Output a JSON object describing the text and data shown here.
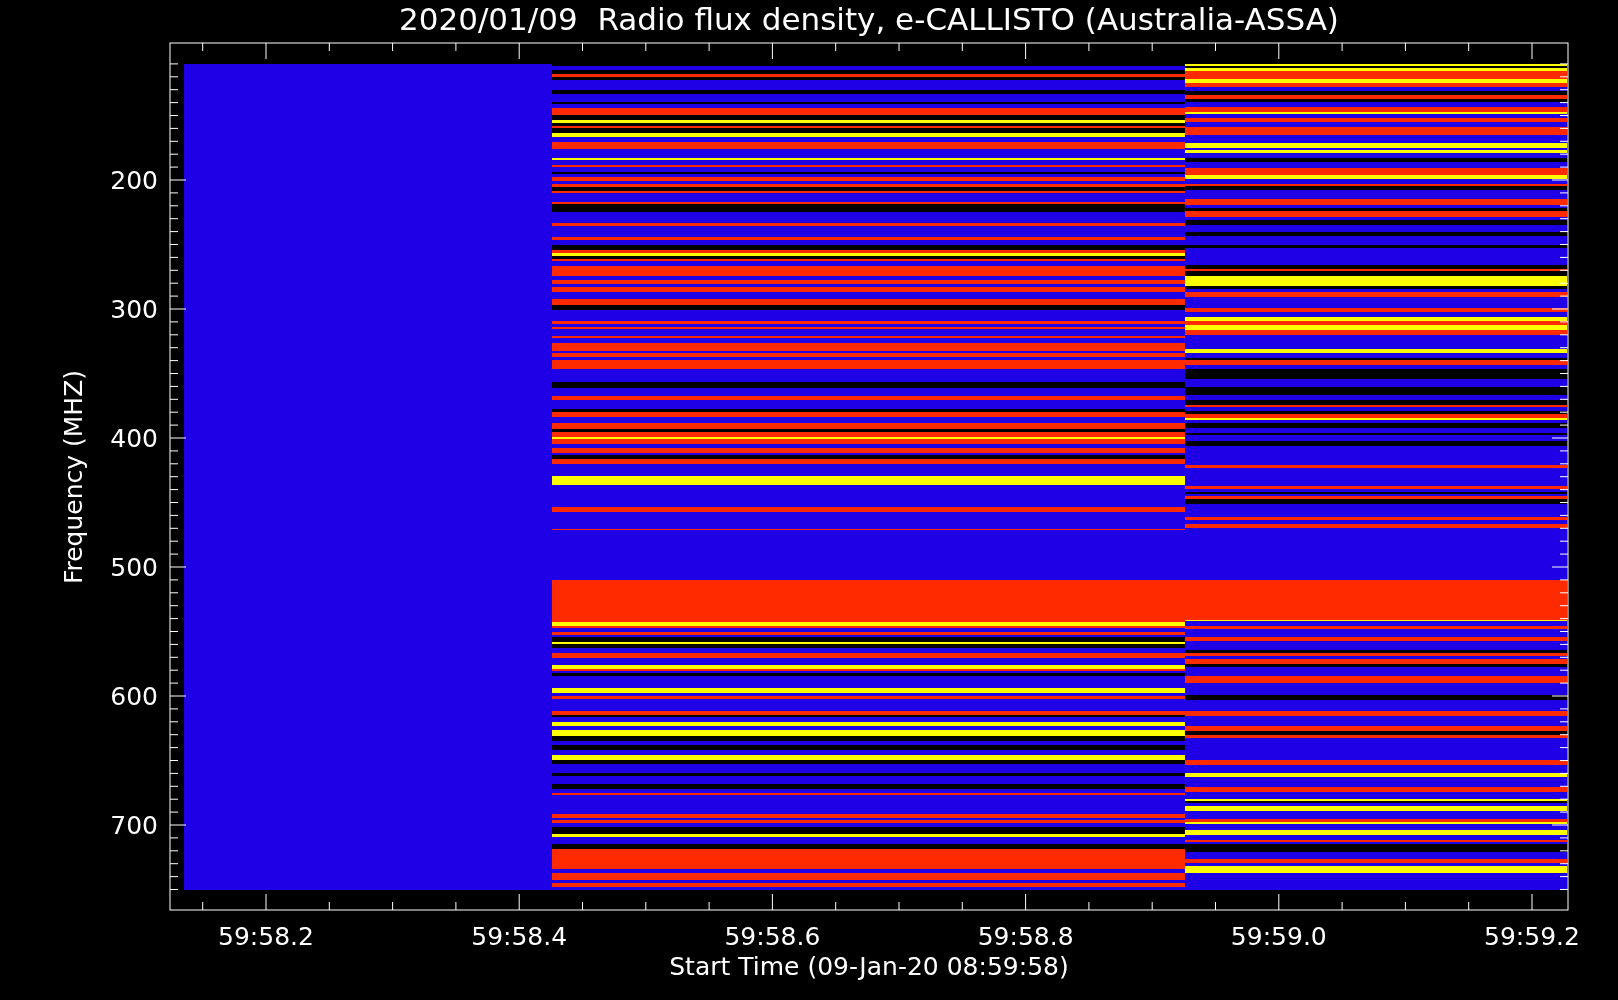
{
  "title": "2020/01/09  Radio flux density, e-CALLISTO (Australia-ASSA)",
  "plot": {
    "ylabel": "Frequency (MHZ)",
    "xlabel": "Start Time (09-Jan-20 08:59:58)",
    "x_tick_labels": [
      "59:58.2",
      "59:58.4",
      "59:58.6",
      "59:58.8",
      "59:59.0",
      "59:59.2"
    ],
    "y_tick_labels": [
      "200",
      "300",
      "400",
      "500",
      "600",
      "700"
    ]
  }
}
